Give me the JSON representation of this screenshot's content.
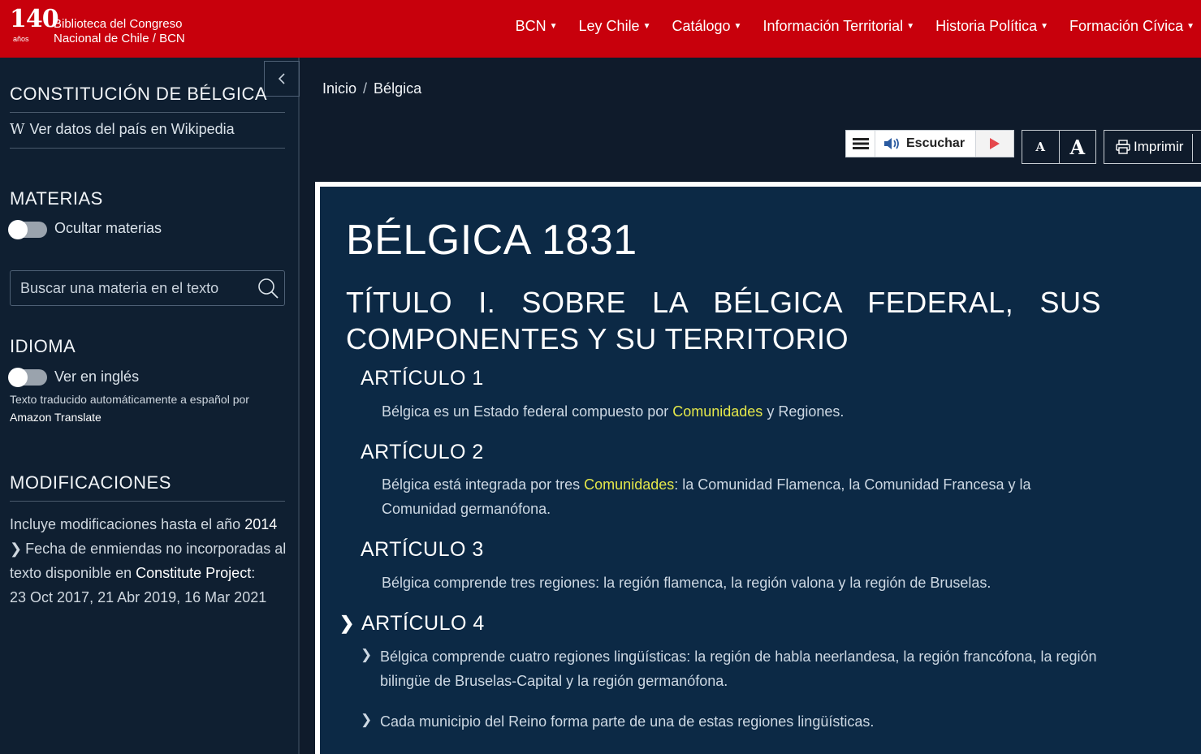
{
  "logo": {
    "number": "140",
    "years": "años",
    "line1": "Biblioteca del Congreso",
    "line2": "Nacional de Chile / BCN"
  },
  "nav": {
    "items": [
      {
        "label": "BCN"
      },
      {
        "label": "Ley Chile"
      },
      {
        "label": "Catálogo"
      },
      {
        "label": "Información Territorial"
      },
      {
        "label": "Historia Política"
      },
      {
        "label": "Formación Cívica"
      }
    ]
  },
  "sidebar": {
    "title": "CONSTITUCIÓN DE BÉLGICA",
    "wiki_icon": "W",
    "wiki_link": "Ver datos del país en Wikipedia",
    "materias_heading": "MATERIAS",
    "hide_materias_label": "Ocultar materias",
    "search_placeholder": "Buscar una materia en el texto",
    "idioma_heading": "IDIOMA",
    "english_label": "Ver en inglés",
    "translate_note": "Texto traducido automáticamente a español por",
    "translate_provider": "Amazon Translate",
    "modificaciones_heading": "MODIFICACIONES",
    "mod_text_prefix": "Incluye modificaciones hasta el año",
    "mod_year": "2014",
    "amend_line1": "Fecha de enmiendas no incorporadas al",
    "amend_line2_prefix": "texto disponible en",
    "amend_source": "Constitute Project",
    "amend_colon": ":",
    "amend_dates": "23 Oct 2017, 21 Abr 2019, 16 Mar 2021"
  },
  "breadcrumb": {
    "home": "Inicio",
    "sep": "/",
    "current": "Bélgica"
  },
  "toolbar": {
    "listen_label": "Escuchar",
    "font_small": "A",
    "font_large": "A",
    "print_label": "Imprimir"
  },
  "document": {
    "title": "BÉLGICA 1831",
    "titulo": "TÍTULO I. SOBRE LA BÉLGICA FEDERAL, SUS COMPONENTES Y SU TERRITORIO",
    "art1": {
      "heading": "ARTÍCULO 1",
      "pre": "Bélgica es un Estado federal compuesto por",
      "highlight": "Comunidades",
      "post": " y Regiones."
    },
    "art2": {
      "heading": "ARTÍCULO 2",
      "pre": "Bélgica está integrada por tres",
      "highlight": "Comunidades",
      "post": ": la Comunidad Flamenca, la Comunidad Francesa y la Comunidad germanófona."
    },
    "art3": {
      "heading": "ARTÍCULO 3",
      "text": "Bélgica comprende tres regiones: la región flamenca, la región valona y la región de Bruselas."
    },
    "art4": {
      "heading": "ARTÍCULO 4",
      "p1": "Bélgica comprende cuatro regiones lingüísticas: la región de habla neerlandesa, la región francófona, la región bilingüe de Bruselas-Capital y la región germanófona.",
      "p2": "Cada municipio del Reino forma parte de una de estas regiones lingüísticas."
    }
  },
  "colors": {
    "topbar": "#c8000c",
    "sidebar": "#0f1f31",
    "content": "#0c2945",
    "highlight": "#e5e84a"
  }
}
